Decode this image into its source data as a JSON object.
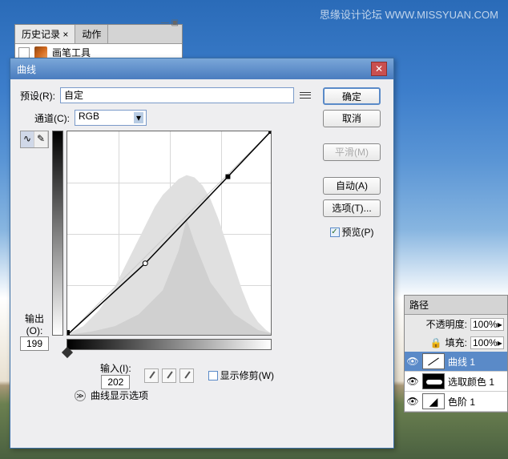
{
  "watermark": "思缘设计论坛 WWW.MISSYUAN.COM",
  "history": {
    "tab1": "历史记录 ×",
    "tab2": "动作",
    "item": "画笔工具"
  },
  "dialog": {
    "title": "曲线",
    "preset_label": "预设(R):",
    "preset_value": "自定",
    "channel_label": "通道(C):",
    "channel_value": "RGB",
    "output_label": "输出(O):",
    "output_value": "199",
    "input_label": "输入(I):",
    "input_value": "202",
    "show_clip": "显示修剪(W)",
    "expand": "曲线显示选项",
    "ok": "确定",
    "cancel": "取消",
    "smooth": "平滑(M)",
    "auto": "自动(A)",
    "options": "选项(T)...",
    "preview": "预览(P)"
  },
  "layers": {
    "tab": "路径",
    "opacity_label": "不透明度:",
    "opacity_value": "100%",
    "fill_label": "填充:",
    "fill_value": "100%",
    "item1": "曲线 1",
    "item2": "选取颜色 1",
    "item3": "色阶 1"
  },
  "chart_data": {
    "type": "line",
    "title": "曲线",
    "xlabel": "输入",
    "ylabel": "输出",
    "xlim": [
      0,
      255
    ],
    "ylim": [
      0,
      255
    ],
    "control_points": [
      {
        "x": 0,
        "y": 0
      },
      {
        "x": 98,
        "y": 90
      },
      {
        "x": 202,
        "y": 199
      },
      {
        "x": 255,
        "y": 255
      }
    ],
    "selected_point": {
      "x": 202,
      "y": 199
    }
  }
}
